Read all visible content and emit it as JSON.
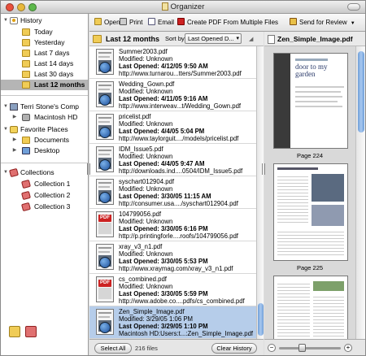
{
  "window": {
    "title": "Organizer"
  },
  "sidebar": {
    "history": {
      "label": "History",
      "items": [
        {
          "label": "Today"
        },
        {
          "label": "Yesterday"
        },
        {
          "label": "Last 7 days"
        },
        {
          "label": "Last 14 days"
        },
        {
          "label": "Last 30 days"
        },
        {
          "label": "Last 12 months",
          "selected": true
        }
      ]
    },
    "computer": {
      "label": "Terri Stone's Comp",
      "children": [
        {
          "label": "Macintosh HD"
        }
      ]
    },
    "favorites": {
      "label": "Favorite Places",
      "children": [
        {
          "label": "Documents"
        },
        {
          "label": "Desktop"
        }
      ]
    },
    "collections": {
      "label": "Collections",
      "items": [
        {
          "label": "Collection 1"
        },
        {
          "label": "Collection 2"
        },
        {
          "label": "Collection 3"
        }
      ]
    }
  },
  "toolbar": {
    "open": "Open",
    "print": "Print",
    "email": "Email",
    "create_pdf": "Create PDF From Multiple Files",
    "send_review": "Send for Review"
  },
  "list_header": {
    "title": "Last 12 months",
    "sort_label": "Sort by",
    "sort_value": "Last Opened D..."
  },
  "files": [
    {
      "name": "Summer2003.pdf",
      "modified": "Modified: Unknown",
      "opened": "Last Opened: 4/12/05 9:50 AM",
      "path": "http://www.turnarou...tters/Summer2003.pdf",
      "icon": "globe"
    },
    {
      "name": "Wedding_Gown.pdf",
      "modified": "Modified: Unknown",
      "opened": "Last Opened: 4/11/05 9:16 AM",
      "path": "http://www.interweav...t/Wedding_Gown.pdf",
      "icon": "globe"
    },
    {
      "name": "pricelist.pdf",
      "modified": "Modified: Unknown",
      "opened": "Last Opened: 4/4/05 5:04 PM",
      "path": "http://www.taylorguit..../models/pricelist.pdf",
      "icon": "globe"
    },
    {
      "name": "IDM_Issue5.pdf",
      "modified": "Modified: Unknown",
      "opened": "Last Opened: 4/4/05 9:47 AM",
      "path": "http://downloads.ind....0504/IDM_Issue5.pdf",
      "icon": "globe"
    },
    {
      "name": "syschart012904.pdf",
      "modified": "Modified: Unknown",
      "opened": "Last Opened: 3/30/05 11:15 AM",
      "path": "http://consumer.usa..../syschart012904.pdf",
      "icon": "globe"
    },
    {
      "name": "104799056.pdf",
      "modified": "Modified: Unknown",
      "opened": "Last Opened: 3/30/05 6:16 PM",
      "path": "http://p.printingforle....roofs/104799056.pdf",
      "icon": "pdf"
    },
    {
      "name": "xray_v3_n1.pdf",
      "modified": "Modified: Unknown",
      "opened": "Last Opened: 3/30/05 5:53 PM",
      "path": "http://www.xraymag.com/xray_v3_n1.pdf",
      "icon": "globe"
    },
    {
      "name": "cs_combined.pdf",
      "modified": "Modified: Unknown",
      "opened": "Last Opened: 3/30/05 5:59 PM",
      "path": "http://www.adobe.co....pdfs/cs_combined.pdf",
      "icon": "pdf"
    },
    {
      "name": "Zen_Simple_Image.pdf",
      "modified": "Modified: 3/29/05 1:06 PM",
      "opened": "Last Opened: 3/29/05 1:10 PM",
      "path": "Macintosh HD:Users:t...:Zen_Simple_Image.pdf",
      "icon": "globe",
      "selected": true
    }
  ],
  "list_footer": {
    "select_all": "Select All",
    "count": "216 files",
    "clear_history": "Clear History"
  },
  "preview": {
    "title": "Zen_Simple_Image.pdf",
    "page1_heading": "door to my garden",
    "pages": [
      {
        "label": "Page 224"
      },
      {
        "label": "Page 225"
      }
    ]
  },
  "colors": {
    "selection": "#b6cdea",
    "sidebar_selection": "#b5b5b5",
    "accent": "#6f9fd8"
  }
}
